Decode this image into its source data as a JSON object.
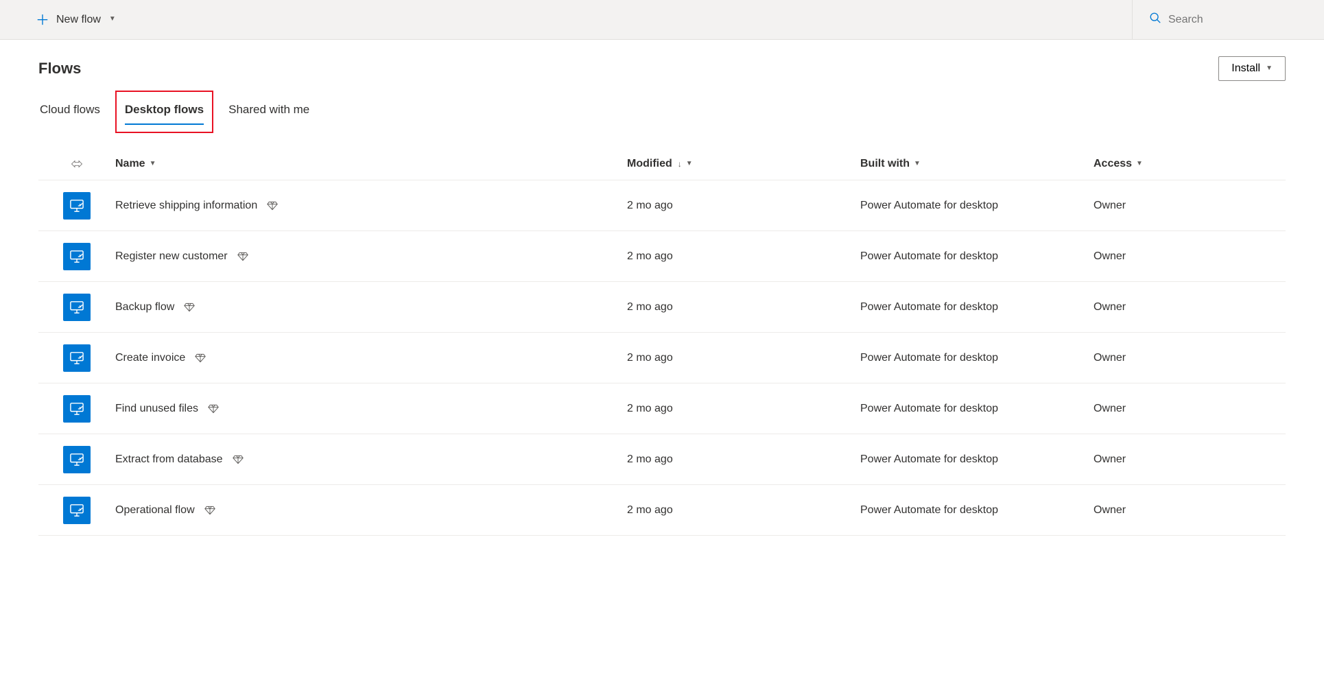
{
  "commandbar": {
    "new_flow_label": "New flow",
    "search_placeholder": "Search"
  },
  "header": {
    "title": "Flows",
    "install_label": "Install"
  },
  "tabs": [
    {
      "label": "Cloud flows",
      "active": false
    },
    {
      "label": "Desktop flows",
      "active": true
    },
    {
      "label": "Shared with me",
      "active": false
    }
  ],
  "columns": {
    "name": "Name",
    "modified": "Modified",
    "built_with": "Built with",
    "access": "Access"
  },
  "rows": [
    {
      "name": "Retrieve shipping information",
      "modified": "2 mo ago",
      "built_with": "Power Automate for desktop",
      "access": "Owner"
    },
    {
      "name": "Register new customer",
      "modified": "2 mo ago",
      "built_with": "Power Automate for desktop",
      "access": "Owner"
    },
    {
      "name": "Backup flow",
      "modified": "2 mo ago",
      "built_with": "Power Automate for desktop",
      "access": "Owner"
    },
    {
      "name": "Create invoice",
      "modified": "2 mo ago",
      "built_with": "Power Automate for desktop",
      "access": "Owner"
    },
    {
      "name": "Find unused files",
      "modified": "2 mo ago",
      "built_with": "Power Automate for desktop",
      "access": "Owner"
    },
    {
      "name": "Extract from database",
      "modified": "2 mo ago",
      "built_with": "Power Automate for desktop",
      "access": "Owner"
    },
    {
      "name": "Operational flow",
      "modified": "2 mo ago",
      "built_with": "Power Automate for desktop",
      "access": "Owner"
    }
  ]
}
